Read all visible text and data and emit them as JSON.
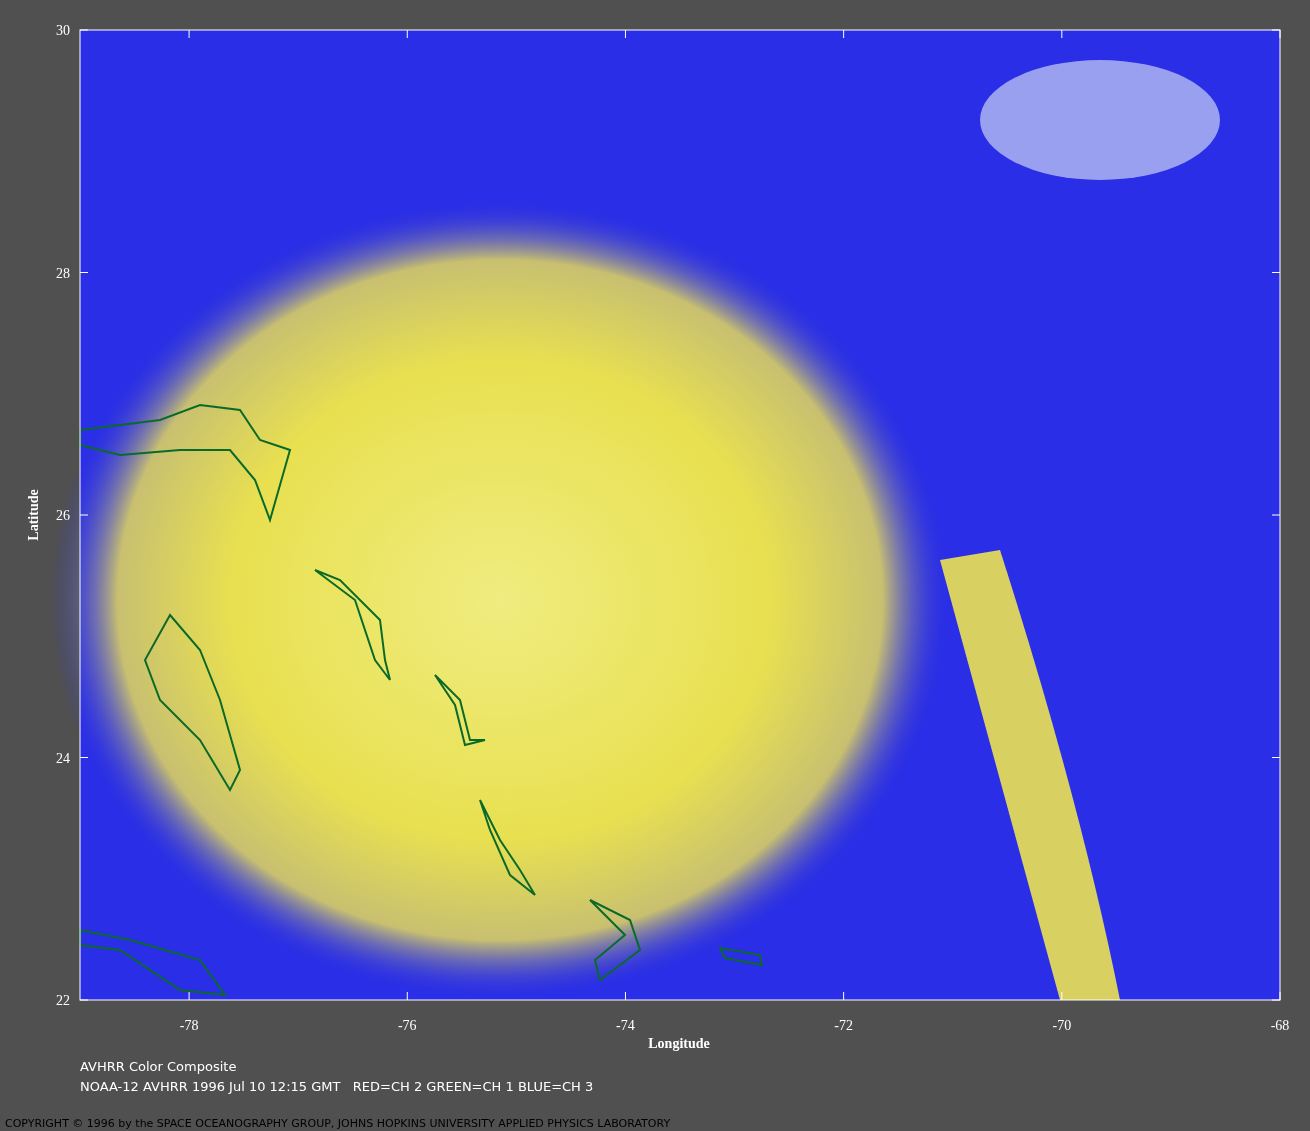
{
  "plot": {
    "ylabel": "Latitude",
    "xlabel": "Longitude",
    "yticks": [
      "30",
      "28",
      "26",
      "24",
      "22"
    ],
    "xticks": [
      "-78",
      "-76",
      "-74",
      "-72",
      "-70",
      "-68"
    ]
  },
  "caption": {
    "title": "AVHRR Color Composite",
    "details": "NOAA-12 AVHRR 1996 Jul 10 12:15 GMT   RED=CH 2 GREEN=CH 1 BLUE=CH 3"
  },
  "copyright": "COPYRIGHT © 1996 by the SPACE OCEANOGRAPHY GROUP, JOHNS HOPKINS UNIVERSITY APPLIED PHYSICS LABORATORY"
}
